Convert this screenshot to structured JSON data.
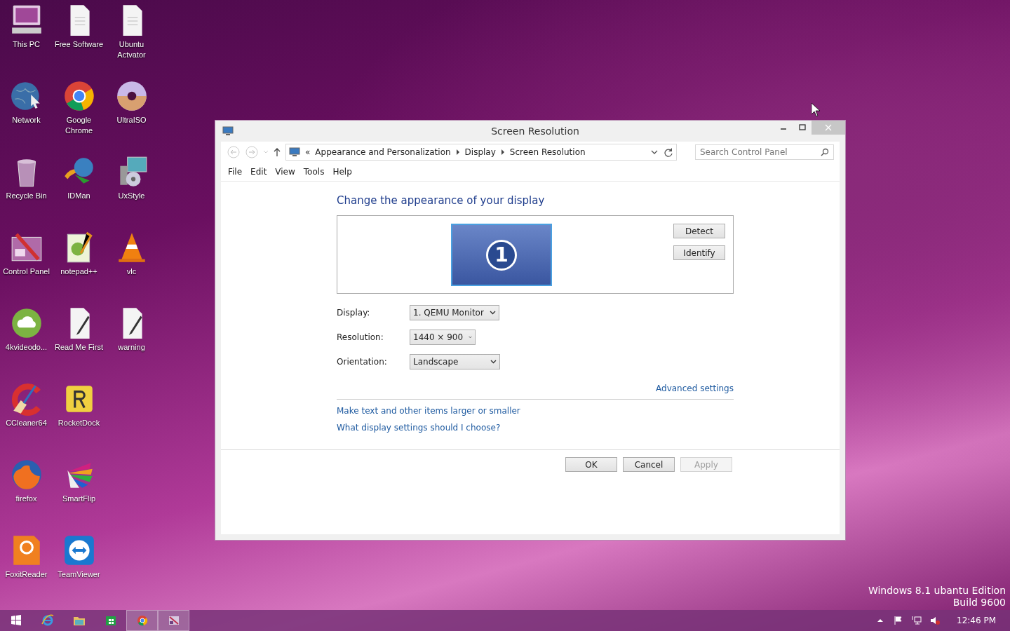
{
  "desktop": {
    "icon_rows": [
      [
        {
          "label": "This PC"
        },
        {
          "label": "Free Software"
        },
        {
          "label": "Ubuntu Actvator"
        }
      ],
      [
        {
          "label": "Network"
        },
        {
          "label": "Google Chrome"
        },
        {
          "label": "UltraISO"
        }
      ],
      [
        {
          "label": "Recycle Bin"
        },
        {
          "label": "IDMan"
        },
        {
          "label": "UxStyle"
        }
      ],
      [
        {
          "label": "Control Panel"
        },
        {
          "label": "notepad++"
        },
        {
          "label": "vlc"
        }
      ],
      [
        {
          "label": "4kvideodo..."
        },
        {
          "label": "Read Me First"
        },
        {
          "label": "warning"
        }
      ],
      [
        {
          "label": "CCleaner64"
        },
        {
          "label": "RocketDock"
        }
      ],
      [
        {
          "label": "firefox"
        },
        {
          "label": "SmartFlip"
        }
      ],
      [
        {
          "label": "FoxitReader"
        },
        {
          "label": "TeamViewer"
        }
      ]
    ]
  },
  "window": {
    "title": "Screen Resolution",
    "address": {
      "overflow": "«",
      "breadcrumb": [
        "Appearance and Personalization",
        "Display",
        "Screen Resolution"
      ]
    },
    "search": {
      "placeholder": "Search Control Panel"
    },
    "menu": [
      "File",
      "Edit",
      "View",
      "Tools",
      "Help"
    ],
    "heading": "Change the appearance of your display",
    "monitor": {
      "number": "1"
    },
    "side_buttons": [
      "Detect",
      "Identify"
    ],
    "fields": [
      {
        "label": "Display:",
        "value": "1. QEMU Monitor"
      },
      {
        "label": "Resolution:",
        "value": "1440 × 900"
      },
      {
        "label": "Orientation:",
        "value": "Landscape"
      }
    ],
    "advanced_link": "Advanced settings",
    "links": [
      "Make text and other items larger or smaller",
      "What display settings should I choose?"
    ],
    "buttons": [
      {
        "label": "OK",
        "disabled": false
      },
      {
        "label": "Cancel",
        "disabled": false
      },
      {
        "label": "Apply",
        "disabled": true
      }
    ]
  },
  "taskbar": {
    "apps": [
      {
        "open": false
      },
      {
        "open": false
      },
      {
        "open": false
      },
      {
        "open": true
      },
      {
        "open": true
      }
    ],
    "clock": "12:46 PM"
  },
  "edition": {
    "title": "Windows 8.1 ubantu Edition",
    "build": "Build 9600"
  }
}
